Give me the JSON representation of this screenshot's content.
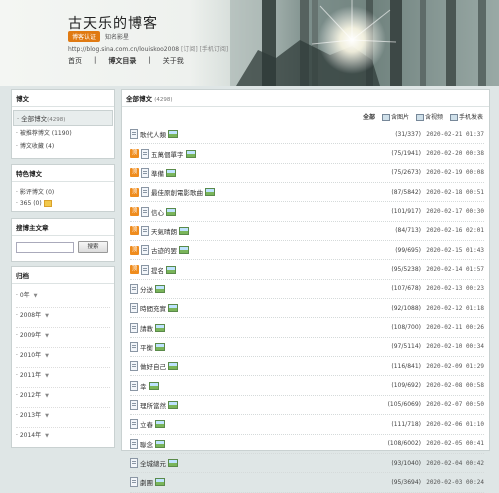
{
  "header": {
    "blog_title": "古天乐的博客",
    "cert_badge": "博客认证",
    "cert_text": "知名影星",
    "url": "http://blog.sina.com.cn/louiskoo2008",
    "url_extra": "[订阅] [手机订阅]",
    "nav": [
      "首页",
      "博文目录",
      "关于我"
    ]
  },
  "sidebar": {
    "posts_panel": {
      "title": "博文",
      "all_label": "全部博文",
      "all_count": "(4298)",
      "recommended": "被推荐博文 (1190)",
      "favorites": "博文收藏 (4)"
    },
    "special_panel": {
      "title": "特色博文",
      "items": [
        "影评博文 (0)",
        "365 (0)"
      ]
    },
    "search_panel": {
      "title": "搜博主文章",
      "button": "搜索"
    },
    "archive_panel": {
      "title": "归档",
      "years": [
        "0年",
        "2008年",
        "2009年",
        "2010年",
        "2011年",
        "2012年",
        "2013年",
        "2014年"
      ]
    }
  },
  "main": {
    "title": "全部博文",
    "count": "(4298)",
    "filters": [
      "全部",
      "含图片",
      "含视频",
      "手机发表"
    ],
    "posts": [
      {
        "top": false,
        "title": "歌代人類",
        "pic": true,
        "stats": "(31/337)",
        "date": "2020-02-21 01:37"
      },
      {
        "top": true,
        "title": "五萬個單字",
        "pic": true,
        "stats": "(75/1941)",
        "date": "2020-02-20 00:38"
      },
      {
        "top": true,
        "title": "準備",
        "pic": true,
        "stats": "(75/2673)",
        "date": "2020-02-19 00:08"
      },
      {
        "top": true,
        "title": "最佳原創電影歌曲",
        "pic": true,
        "stats": "(87/5842)",
        "date": "2020-02-18 00:51"
      },
      {
        "top": true,
        "title": "信心",
        "pic": true,
        "stats": "(101/917)",
        "date": "2020-02-17 00:30"
      },
      {
        "top": true,
        "title": "天氣晴朗",
        "pic": true,
        "stats": "(84/713)",
        "date": "2020-02-16 02:01"
      },
      {
        "top": true,
        "title": "古迹的罢",
        "pic": true,
        "stats": "(99/695)",
        "date": "2020-02-15 01:43"
      },
      {
        "top": true,
        "title": "提名",
        "pic": true,
        "stats": "(95/5238)",
        "date": "2020-02-14 01:57"
      },
      {
        "top": false,
        "title": "分送",
        "pic": true,
        "stats": "(107/678)",
        "date": "2020-02-13 00:23"
      },
      {
        "top": false,
        "title": "時間充實",
        "pic": true,
        "stats": "(92/1088)",
        "date": "2020-02-12 01:18"
      },
      {
        "top": false,
        "title": "請教",
        "pic": true,
        "stats": "(108/700)",
        "date": "2020-02-11 00:26"
      },
      {
        "top": false,
        "title": "平衡",
        "pic": true,
        "stats": "(97/5114)",
        "date": "2020-02-10 00:34"
      },
      {
        "top": false,
        "title": "做好自己",
        "pic": true,
        "stats": "(116/841)",
        "date": "2020-02-09 01:29"
      },
      {
        "top": false,
        "title": "幸",
        "pic": true,
        "stats": "(109/692)",
        "date": "2020-02-08 00:58"
      },
      {
        "top": false,
        "title": "理所當然",
        "pic": true,
        "stats": "(105/6069)",
        "date": "2020-02-07 00:50"
      },
      {
        "top": false,
        "title": "立春",
        "pic": true,
        "stats": "(111/718)",
        "date": "2020-02-06 01:10"
      },
      {
        "top": false,
        "title": "聯念",
        "pic": true,
        "stats": "(108/6002)",
        "date": "2020-02-05 00:41"
      },
      {
        "top": false,
        "title": "全城總元",
        "pic": true,
        "stats": "(93/1040)",
        "date": "2020-02-04 00:42"
      },
      {
        "top": false,
        "title": "劇團",
        "pic": true,
        "stats": "(95/3694)",
        "date": "2020-02-03 00:24"
      }
    ]
  }
}
